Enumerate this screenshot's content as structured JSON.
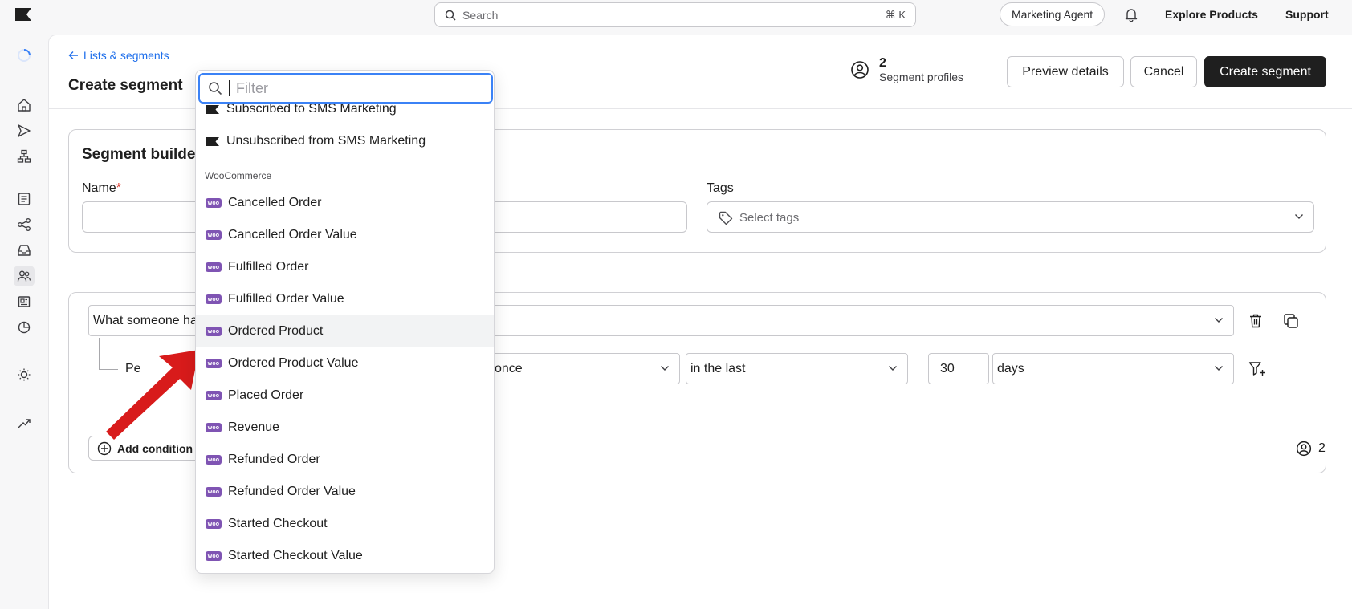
{
  "topbar": {
    "search_placeholder": "Search",
    "search_shortcut": "⌘ K",
    "agent_label": "Marketing Agent",
    "explore_label": "Explore Products",
    "support_label": "Support"
  },
  "header": {
    "back_label": "Lists & segments",
    "title": "Create segment",
    "profiles_count": "2",
    "profiles_label": "Segment profiles",
    "preview_label": "Preview details",
    "cancel_label": "Cancel",
    "create_label": "Create segment"
  },
  "builder": {
    "title": "Segment builde",
    "name_label": "Name",
    "required_mark": "*",
    "tags_label": "Tags",
    "tags_placeholder": "Select tags"
  },
  "conditions": {
    "condition_type": "What someone ha",
    "row_prefix": "Pe",
    "frequency": "once",
    "timeframe": "in the last",
    "amount": "30",
    "unit": "days",
    "add_label": "Add condition",
    "count": "2"
  },
  "dropdown": {
    "filter_placeholder": "Filter",
    "top_items": [
      "Subscribed to SMS Marketing",
      "Unsubscribed from SMS Marketing"
    ],
    "group_label": "WooCommerce",
    "woo_badge": "woo",
    "woo_items": [
      "Cancelled Order",
      "Cancelled Order Value",
      "Fulfilled Order",
      "Fulfilled Order Value",
      "Ordered Product",
      "Ordered Product Value",
      "Placed Order",
      "Revenue",
      "Refunded Order",
      "Refunded Order Value",
      "Started Checkout",
      "Started Checkout Value"
    ],
    "hovered_index": 4
  },
  "colors": {
    "accent_blue": "#3b82f6",
    "link_blue": "#1f6feb",
    "primary_dark": "#1f1f1f",
    "woo_purple": "#7f54b3",
    "arrow_red": "#d81b1b"
  }
}
